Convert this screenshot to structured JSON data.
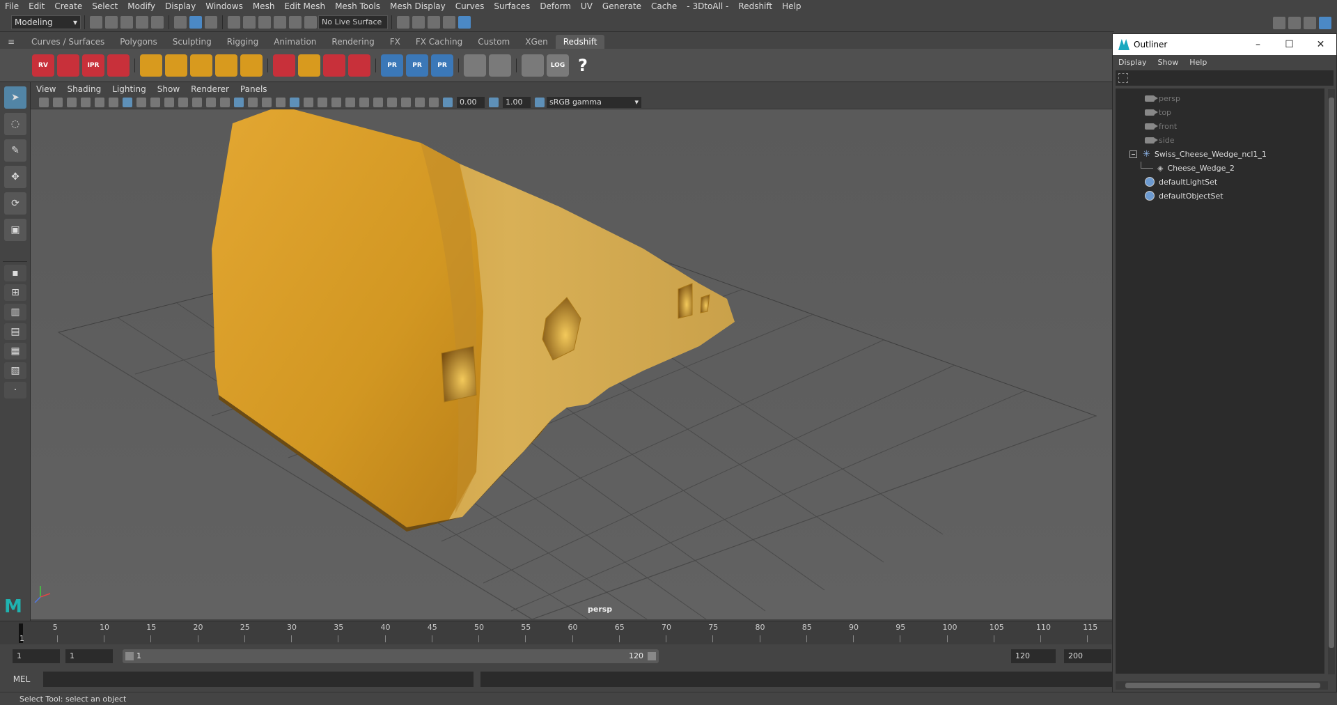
{
  "menubar": {
    "items": [
      "File",
      "Edit",
      "Create",
      "Select",
      "Modify",
      "Display",
      "Windows",
      "Mesh",
      "Edit Mesh",
      "Mesh Tools",
      "Mesh Display",
      "Curves",
      "Surfaces",
      "Deform",
      "UV",
      "Generate",
      "Cache",
      "- 3DtoAll -",
      "Redshift",
      "Help"
    ]
  },
  "statusline": {
    "mode": "Modeling",
    "live_surface": "No Live Surface"
  },
  "shelf": {
    "tabs": [
      "Curves / Surfaces",
      "Polygons",
      "Sculpting",
      "Rigging",
      "Animation",
      "Rendering",
      "FX",
      "FX Caching",
      "Custom",
      "XGen",
      "Redshift"
    ],
    "active_tab": "Redshift",
    "redshift_labels": [
      "RV",
      "IPR",
      "PR",
      "PR",
      "PR",
      "LOG",
      "?"
    ]
  },
  "panel": {
    "menus": [
      "View",
      "Shading",
      "Lighting",
      "Show",
      "Renderer",
      "Panels"
    ],
    "exposure": "0.00",
    "gamma": "1.00",
    "colorspace": "sRGB gamma",
    "camera": "persp"
  },
  "timeline": {
    "ticks": [
      "5",
      "10",
      "15",
      "20",
      "25",
      "30",
      "35",
      "40",
      "45",
      "50",
      "55",
      "60",
      "65",
      "70",
      "75",
      "80",
      "85",
      "90",
      "95",
      "100",
      "105",
      "110",
      "115"
    ],
    "current_frame": "1"
  },
  "range": {
    "start": "1",
    "playback_start": "1",
    "slider_start": "1",
    "slider_end": "120",
    "playback_end": "120",
    "end": "200"
  },
  "commandline": {
    "label": "MEL",
    "help": "Select Tool: select an object"
  },
  "outliner": {
    "title": "Outliner",
    "menus": [
      "Display",
      "Show",
      "Help"
    ],
    "cameras": [
      "persp",
      "top",
      "front",
      "side"
    ],
    "group": "Swiss_Cheese_Wedge_ncl1_1",
    "child": "Cheese_Wedge_2",
    "sets": [
      "defaultLightSet",
      "defaultObjectSet"
    ]
  },
  "colors": {
    "accent": "#5285a6",
    "cheese": "#d69b2a",
    "viewport_bg": "#5e5e5e"
  }
}
